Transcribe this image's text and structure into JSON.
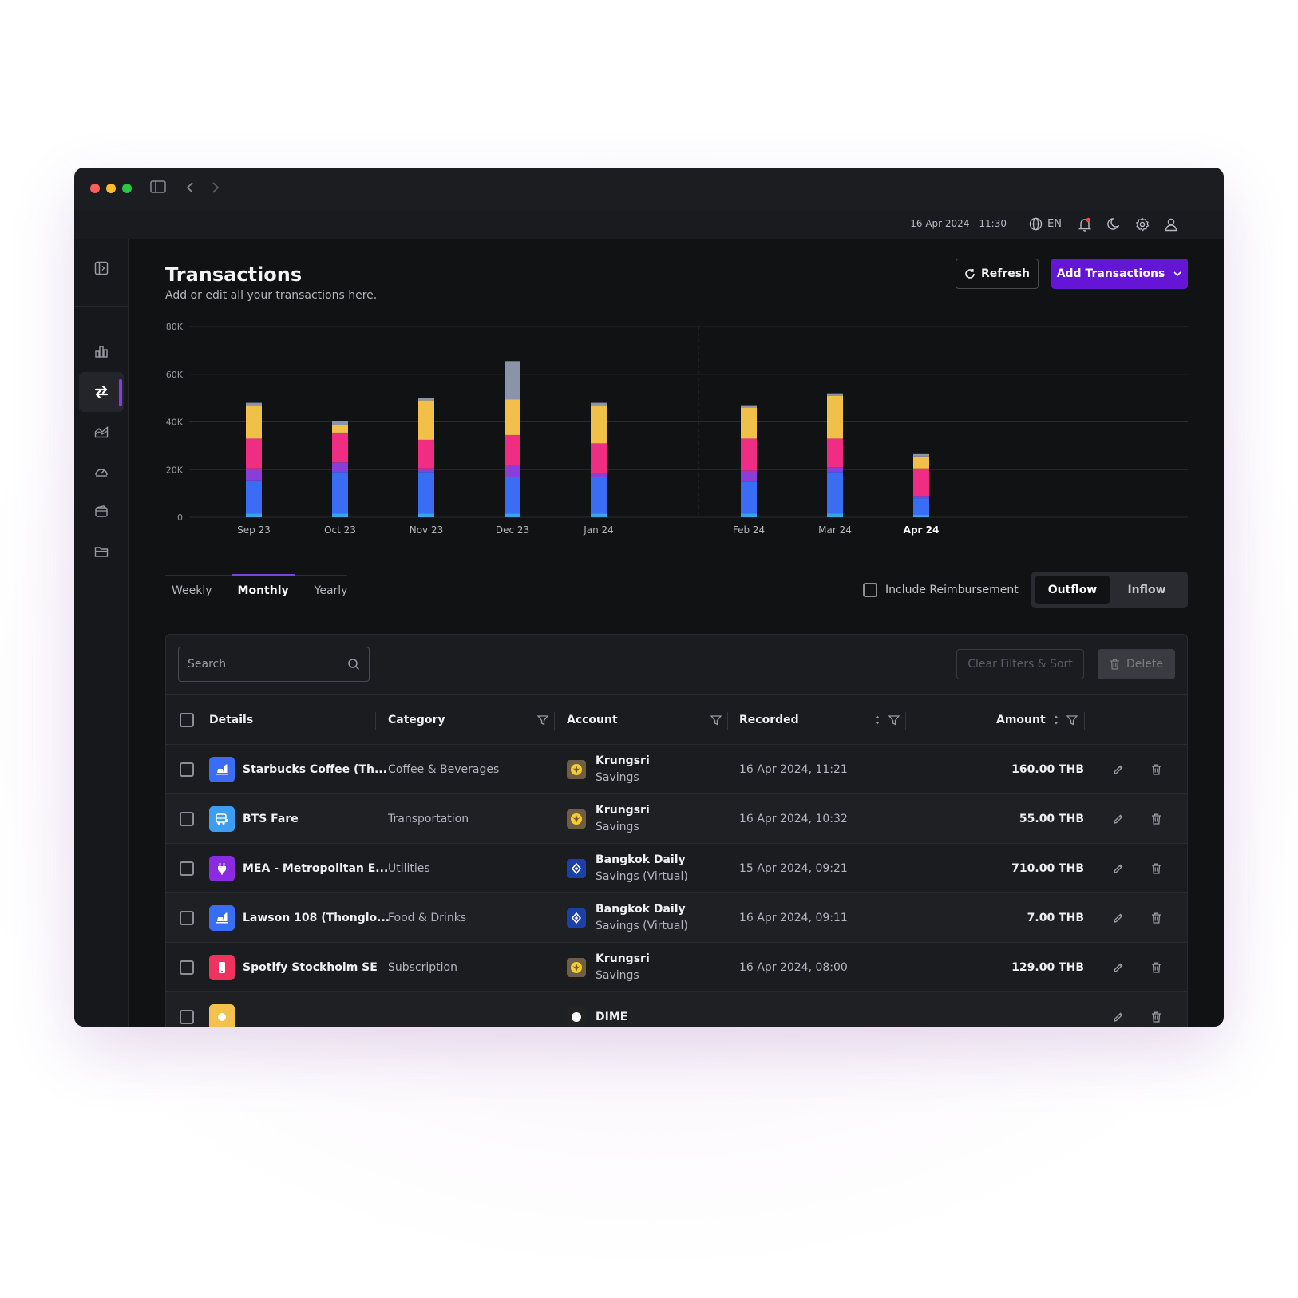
{
  "topbar": {
    "datetime": "16 Apr 2024 - 11:30",
    "language": "EN"
  },
  "page": {
    "title": "Transactions",
    "subtitle": "Add or edit all your transactions here."
  },
  "buttons": {
    "refresh": "Refresh",
    "add": "Add Transactions",
    "clear": "Clear Filters & Sort",
    "delete": "Delete"
  },
  "tabs": [
    "Weekly",
    "Monthly",
    "Yearly"
  ],
  "active_tab": "Monthly",
  "reimbursement_label": "Include Reimbursement",
  "flow": {
    "outflow": "Outflow",
    "inflow": "Inflow",
    "active": "Outflow"
  },
  "search": {
    "placeholder": "Search"
  },
  "columns": {
    "details": "Details",
    "category": "Category",
    "account": "Account",
    "recorded": "Recorded",
    "amount": "Amount"
  },
  "rows": [
    {
      "name": "Starbucks Coffee (Th...",
      "category": "Coffee & Beverages",
      "account_name": "Krungsri",
      "account_type": "Savings",
      "bank": "krungsri",
      "icon": "food-icon",
      "icon_color": "#3b6cf5",
      "recorded": "16 Apr 2024, 11:21",
      "amount": "160.00 THB"
    },
    {
      "name": "BTS Fare",
      "category": "Transportation",
      "account_name": "Krungsri",
      "account_type": "Savings",
      "bank": "krungsri",
      "icon": "bus-icon",
      "icon_color": "#3d9df0",
      "recorded": "16 Apr 2024, 10:32",
      "amount": "55.00 THB"
    },
    {
      "name": "MEA - Metropolitan E...",
      "category": "Utilities",
      "account_name": "Bangkok Daily",
      "account_type": "Savings (Virtual)",
      "bank": "bbl",
      "icon": "plug-icon",
      "icon_color": "#8a2be2",
      "recorded": "15 Apr 2024, 09:21",
      "amount": "710.00 THB"
    },
    {
      "name": "Lawson 108 (Thonglo...",
      "category": "Food & Drinks",
      "account_name": "Bangkok Daily",
      "account_type": "Savings (Virtual)",
      "bank": "bbl",
      "icon": "food-icon",
      "icon_color": "#3b6cf5",
      "recorded": "16 Apr 2024, 09:11",
      "amount": "7.00 THB"
    },
    {
      "name": "Spotify Stockholm SE",
      "category": "Subscription",
      "account_name": "Krungsri",
      "account_type": "Savings",
      "bank": "krungsri",
      "icon": "phone-icon",
      "icon_color": "#f0325e",
      "recorded": "16 Apr 2024, 08:00",
      "amount": "129.00 THB"
    },
    {
      "name": "",
      "category": "",
      "account_name": "DIME",
      "account_type": "",
      "bank": "dime",
      "icon": "category-icon",
      "icon_color": "#f2c14e",
      "recorded": "",
      "amount": ""
    }
  ],
  "colors": {
    "accent": "#7b3fe4",
    "primary_button": "#6515d6",
    "segments": [
      "#38a5e8",
      "#3a6cf4",
      "#8a3ed8",
      "#ef2d83",
      "#f0c048",
      "#8a93a8"
    ]
  },
  "chart_data": {
    "type": "bar",
    "stacked": true,
    "categories": [
      "Sep 23",
      "Oct 23",
      "Nov 23",
      "Dec 23",
      "Jan 24",
      "Feb 24",
      "Mar 24",
      "Apr 24"
    ],
    "highlight_category": "Apr 24",
    "ylim": [
      0,
      80000
    ],
    "y_ticks": [
      "0",
      "20K",
      "40K",
      "60K",
      "80K"
    ],
    "grid": true,
    "series": [
      {
        "color": "#38a5e8",
        "values": [
          1500,
          1500,
          1500,
          1500,
          1500,
          1500,
          1500,
          1000
        ]
      },
      {
        "color": "#3a6cf4",
        "values": [
          14000,
          17500,
          17500,
          15500,
          15500,
          13500,
          17500,
          7000
        ]
      },
      {
        "color": "#8a3ed8",
        "values": [
          5000,
          4000,
          1500,
          5000,
          1500,
          4500,
          2000,
          1000
        ]
      },
      {
        "color": "#ef2d83",
        "values": [
          12500,
          12500,
          12000,
          12500,
          12500,
          13500,
          12000,
          11500
        ]
      },
      {
        "color": "#f0c048",
        "values": [
          14000,
          3000,
          16500,
          15000,
          16000,
          13000,
          18000,
          5000
        ]
      },
      {
        "color": "#8a93a8",
        "values": [
          1000,
          2000,
          1000,
          16000,
          1000,
          1000,
          1000,
          1000
        ]
      }
    ]
  }
}
